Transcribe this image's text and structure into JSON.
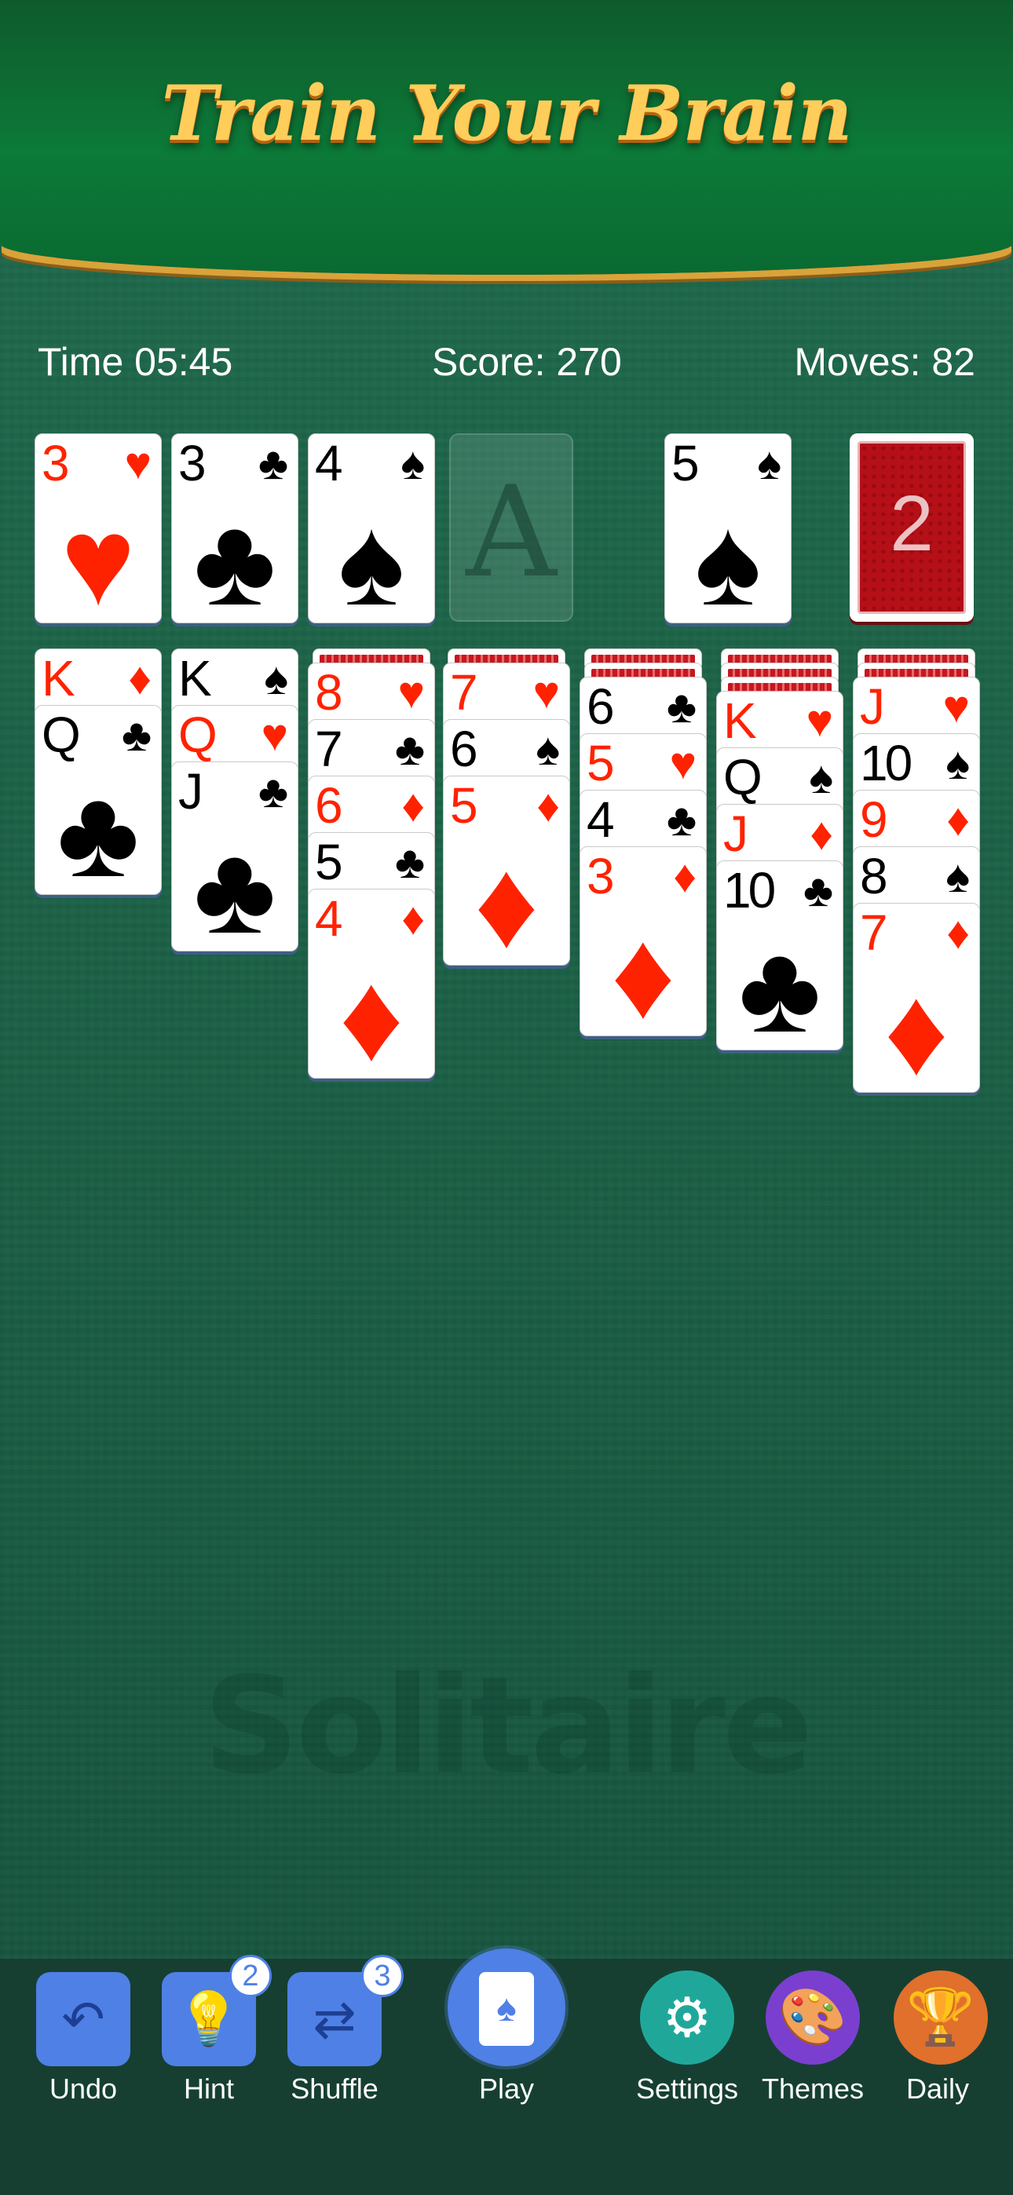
{
  "banner": {
    "title": "Train Your Brain"
  },
  "stats": {
    "time": "Time  05:45",
    "score": "Score: 270",
    "moves": "Moves: 82"
  },
  "top_row": {
    "foundations": [
      {
        "rank": "3",
        "suit": "♥",
        "color": "red"
      },
      {
        "rank": "3",
        "suit": "♣",
        "color": "black"
      },
      {
        "rank": "4",
        "suit": "♠",
        "color": "black"
      }
    ],
    "empty_foundation": "A",
    "waste": {
      "rank": "5",
      "suit": "♠",
      "color": "black"
    },
    "stock_count": "2"
  },
  "tableau": [
    {
      "hidden": 0,
      "cards": [
        {
          "rank": "K",
          "suit": "♦",
          "color": "red"
        },
        {
          "rank": "Q",
          "suit": "♣",
          "color": "black"
        }
      ]
    },
    {
      "hidden": 0,
      "cards": [
        {
          "rank": "K",
          "suit": "♠",
          "color": "black"
        },
        {
          "rank": "Q",
          "suit": "♥",
          "color": "red"
        },
        {
          "rank": "J",
          "suit": "♣",
          "color": "black"
        }
      ]
    },
    {
      "hidden": 1,
      "cards": [
        {
          "rank": "8",
          "suit": "♥",
          "color": "red"
        },
        {
          "rank": "7",
          "suit": "♣",
          "color": "black"
        },
        {
          "rank": "6",
          "suit": "♦",
          "color": "red"
        },
        {
          "rank": "5",
          "suit": "♣",
          "color": "black"
        },
        {
          "rank": "4",
          "suit": "♦",
          "color": "red"
        }
      ]
    },
    {
      "hidden": 1,
      "cards": [
        {
          "rank": "7",
          "suit": "♥",
          "color": "red"
        },
        {
          "rank": "6",
          "suit": "♠",
          "color": "black"
        },
        {
          "rank": "5",
          "suit": "♦",
          "color": "red"
        }
      ]
    },
    {
      "hidden": 2,
      "cards": [
        {
          "rank": "6",
          "suit": "♣",
          "color": "black"
        },
        {
          "rank": "5",
          "suit": "♥",
          "color": "red"
        },
        {
          "rank": "4",
          "suit": "♣",
          "color": "black"
        },
        {
          "rank": "3",
          "suit": "♦",
          "color": "red"
        }
      ]
    },
    {
      "hidden": 3,
      "cards": [
        {
          "rank": "K",
          "suit": "♥",
          "color": "red"
        },
        {
          "rank": "Q",
          "suit": "♠",
          "color": "black"
        },
        {
          "rank": "J",
          "suit": "♦",
          "color": "red"
        },
        {
          "rank": "10",
          "suit": "♣",
          "color": "black"
        }
      ]
    },
    {
      "hidden": 2,
      "cards": [
        {
          "rank": "J",
          "suit": "♥",
          "color": "red"
        },
        {
          "rank": "10",
          "suit": "♠",
          "color": "black"
        },
        {
          "rank": "9",
          "suit": "♦",
          "color": "red"
        },
        {
          "rank": "8",
          "suit": "♠",
          "color": "black"
        },
        {
          "rank": "7",
          "suit": "♦",
          "color": "red"
        }
      ]
    }
  ],
  "watermark": "Solitaire",
  "toolbar": {
    "undo": "Undo",
    "hint": "Hint",
    "hint_badge": "2",
    "shuffle": "Shuffle",
    "shuffle_badge": "3",
    "play": "Play",
    "settings": "Settings",
    "themes": "Themes",
    "daily": "Daily"
  },
  "colors": {
    "red": "#ff2200",
    "black": "#000000",
    "accent": "#4f80e5",
    "table": "#1b5e45"
  }
}
